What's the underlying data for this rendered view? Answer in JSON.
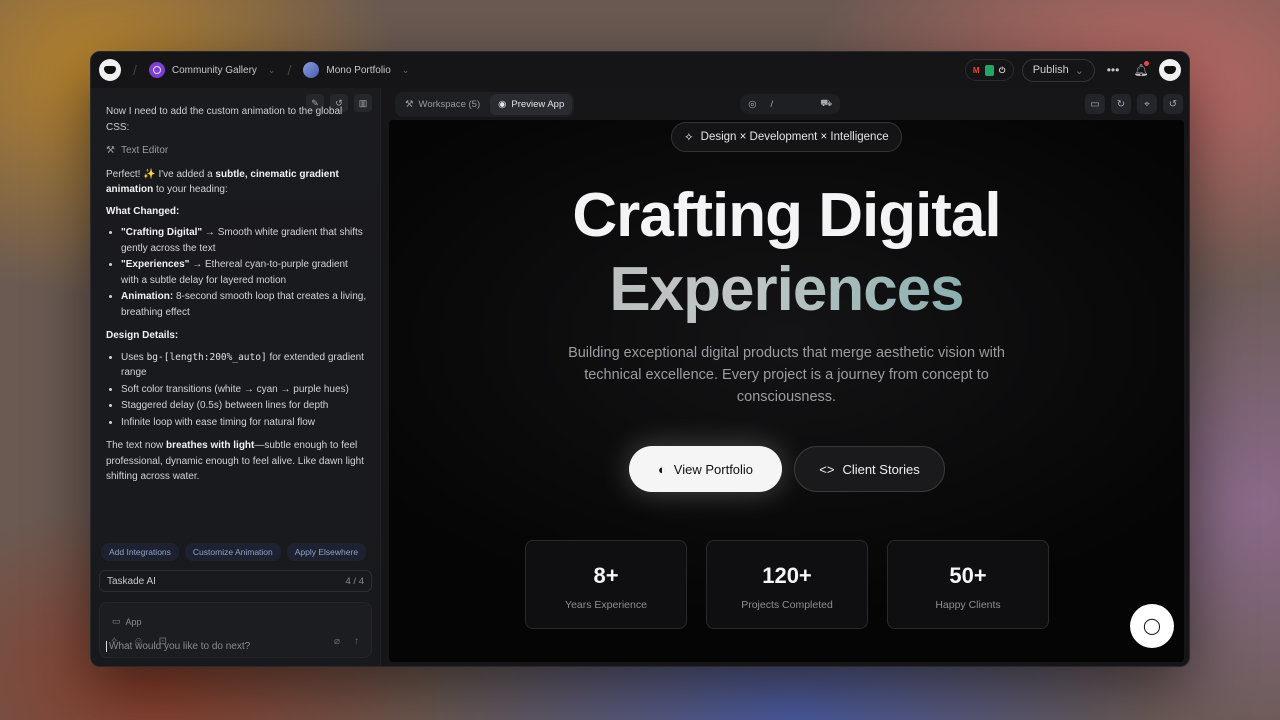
{
  "titlebar": {
    "workspace": "Community Gallery",
    "project": "Mono Portfolio",
    "publish_label": "Publish"
  },
  "sidebar": {
    "chat": {
      "cut_line": "Now I need to add the custom animation to the global CSS:",
      "tool_label": "Text Editor",
      "intro_pre": "Perfect! ✨ I've added a ",
      "intro_bold": "subtle, cinematic gradient animation",
      "intro_post": " to your heading:",
      "what_changed_heading": "What Changed:",
      "changes": [
        {
          "bold": "\"Crafting Digital\"",
          "text": " → Smooth white gradient that shifts gently across the text"
        },
        {
          "bold": "\"Experiences\"",
          "text": " → Ethereal cyan-to-purple gradient with a subtle delay for layered motion"
        },
        {
          "bold": "Animation:",
          "text": " 8-second smooth loop that creates a living, breathing effect"
        }
      ],
      "design_details_heading": "Design Details:",
      "details": [
        {
          "pre": "Uses ",
          "code": "bg-[length:200%_auto]",
          "post": " for extended gradient range"
        },
        {
          "pre": "Soft color transitions (white → cyan → purple hues)",
          "code": "",
          "post": ""
        },
        {
          "pre": "Staggered delay (0.5s) between lines for depth",
          "code": "",
          "post": ""
        },
        {
          "pre": "Infinite loop with ease timing for natural flow",
          "code": "",
          "post": ""
        }
      ],
      "outro_pre": "The text now ",
      "outro_bold": "breathes with light",
      "outro_post": "—subtle enough to feel professional, dynamic enough to feel alive. Like dawn light shifting across water."
    },
    "chips": [
      "Add Integrations",
      "Customize Animation",
      "Apply Elsewhere"
    ],
    "agent": {
      "name": "Taskade AI",
      "count": "4 / 4"
    },
    "composer": {
      "app_tag": "App",
      "placeholder": "What would you like to do next?"
    }
  },
  "toolbar": {
    "workspace_tab": "Workspace (5)",
    "preview_tab": "Preview App",
    "url_path": "/"
  },
  "preview": {
    "badge": "Design × Development × Intelligence",
    "hero_line1": "Crafting Digital",
    "hero_line2": "Experiences",
    "subtitle": "Building exceptional digital products that merge aesthetic vision with technical excellence. Every project is a journey from concept to consciousness.",
    "primary_button": "View Portfolio",
    "secondary_button": "Client Stories",
    "stats": [
      {
        "value": "8+",
        "label": "Years Experience"
      },
      {
        "value": "120+",
        "label": "Projects Completed"
      },
      {
        "value": "50+",
        "label": "Happy Clients"
      }
    ]
  }
}
